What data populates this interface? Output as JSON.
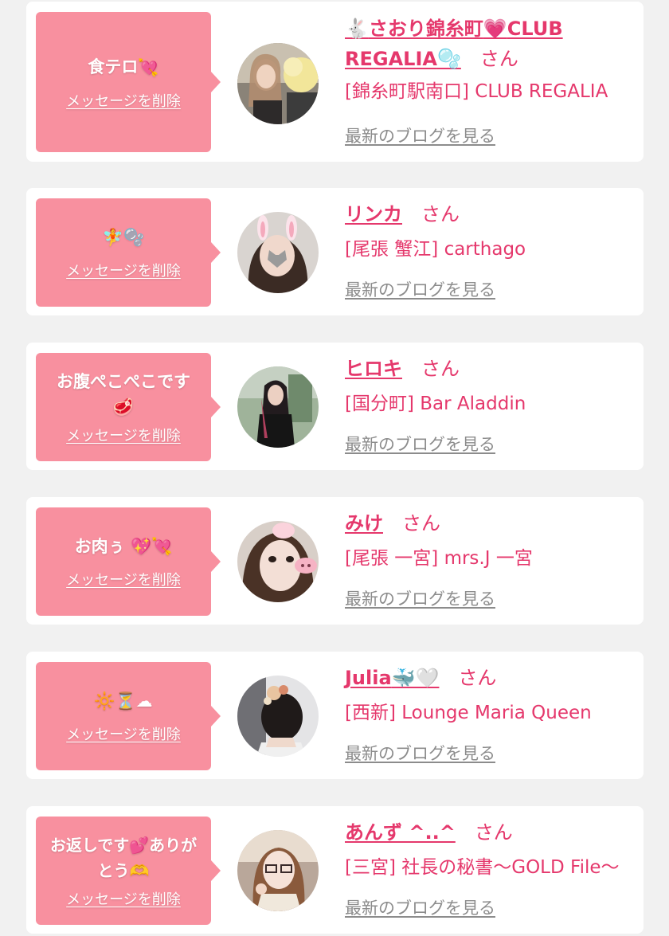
{
  "common": {
    "delete_label": "メッセージを削除",
    "blog_label": "最新のブログを見る",
    "san": "さん"
  },
  "cards": [
    {
      "message": "食テロ",
      "message_emoji": "heart-arrow-icon",
      "name": "さおり錦糸町",
      "name_full": "🐇さおり錦糸町💗CLUB REGALIA🫧",
      "name_text_a": "さおり錦糸町",
      "name_text_b": "CLUB REGALIA",
      "shop": "[錦糸町駅南口] CLUB REGALIA"
    },
    {
      "message": "🧚🫧",
      "name": "リンカ",
      "shop": "[尾張 蟹江] carthago"
    },
    {
      "message": "お腹ぺこぺこです🥩",
      "name": "ヒロキ",
      "shop": "[国分町] Bar Aladdin"
    },
    {
      "message": "お肉ぅ 💖💘",
      "name": "みけ",
      "shop": "[尾張 一宮] mrs.J 一宮"
    },
    {
      "message": "🔆⏳☁",
      "name": "Julia",
      "name_suffix": "🐳🤍",
      "shop": "[西新] Lounge Maria Queen"
    },
    {
      "message": "お返しです💕ありがとう🫶",
      "name": "あんず ^..^",
      "shop": "[三宮] 社長の秘書～GOLD File～"
    }
  ],
  "colors": {
    "page_bg": "#f1f1f1",
    "bubble": "#f8909f",
    "accent": "#e5386c",
    "link_gray": "#8c8c8c"
  }
}
